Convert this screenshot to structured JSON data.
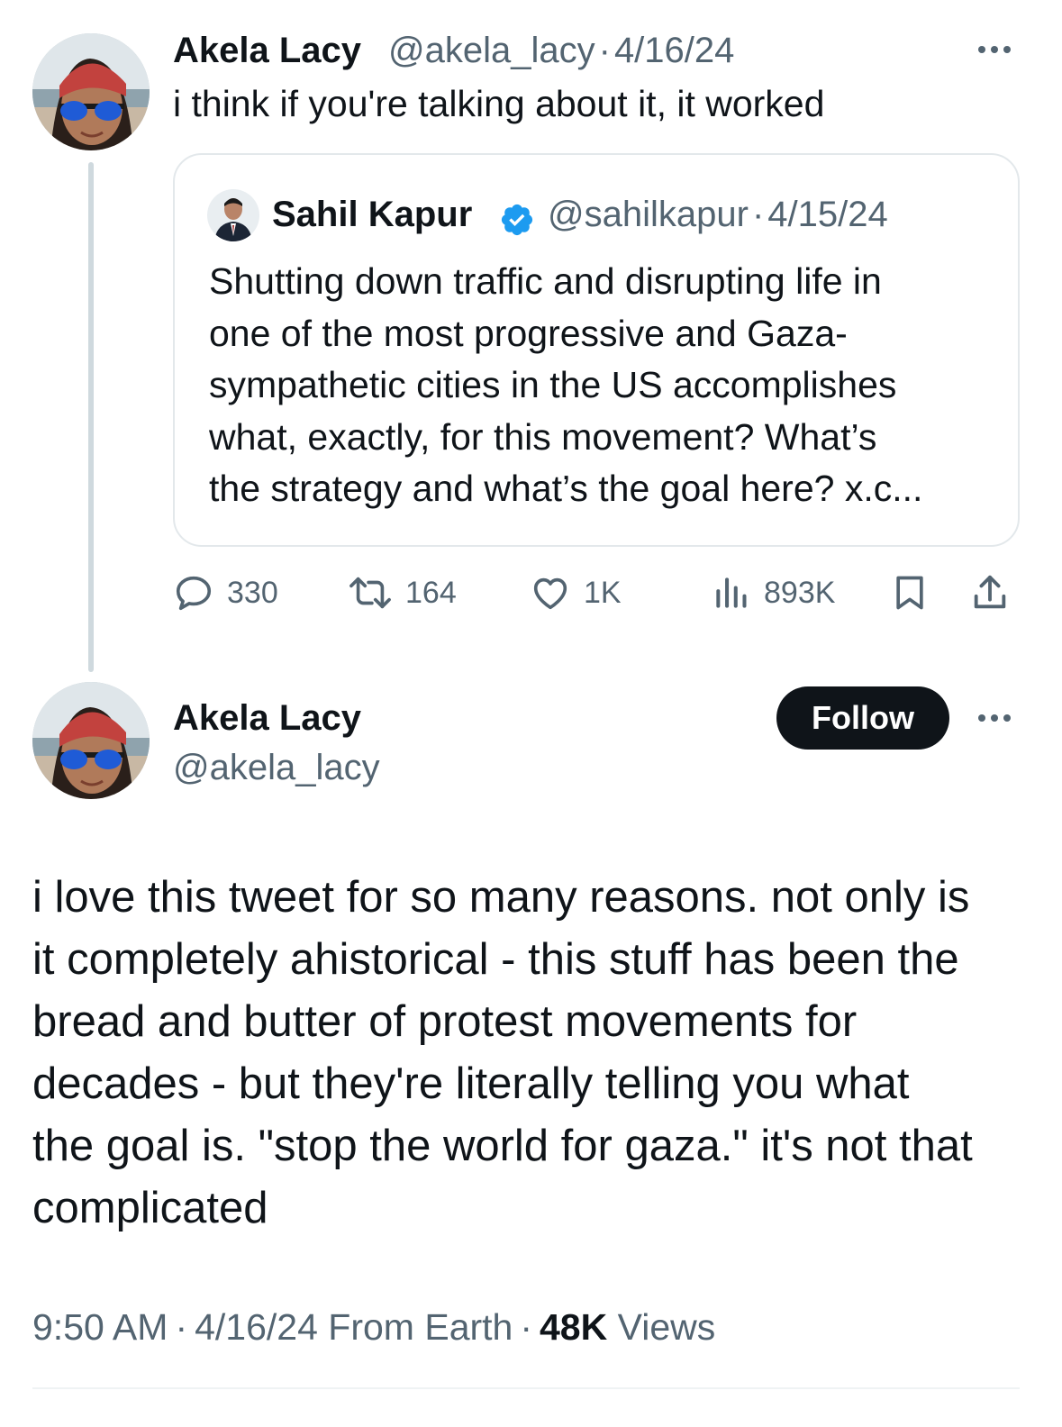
{
  "reply": {
    "author_name": "Akela Lacy",
    "handle": "@akela_lacy",
    "separator": "·",
    "date": "4/16/24",
    "text": "i think if you're talking about it, it worked",
    "more_icon": "more-horizontal-icon"
  },
  "quoted_tweet": {
    "author_name": "Sahil Kapur",
    "verified": true,
    "handle": "@sahilkapur",
    "separator": "·",
    "date": "4/15/24",
    "lines": [
      "Shutting down traffic and disrupting life in",
      "one of the most progressive and Gaza-",
      "sympathetic cities in the US accomplishes",
      "what, exactly, for this movement? What’s",
      "the strategy and what’s the goal here? x.c..."
    ]
  },
  "actions": {
    "replies": "330",
    "reposts": "164",
    "likes": "1K",
    "views": "893K",
    "bookmark_icon": "bookmark-icon",
    "share_icon": "share-icon"
  },
  "main_tweet": {
    "author_name": "Akela Lacy",
    "handle": "@akela_lacy",
    "follow_label": "Follow",
    "lines": [
      "i love this tweet for so many reasons. not only is",
      "it completely ahistorical - this stuff has been the",
      "bread and butter of protest movements for",
      "decades - but they're literally telling you what",
      "the goal is. \"stop the world for gaza.\" it's not that",
      "complicated"
    ],
    "time": "9:50 AM",
    "sep1": "·",
    "date": "4/16/24",
    "source": "From Earth",
    "sep2": "·",
    "views_count": "48K",
    "views_label": "Views"
  },
  "colors": {
    "text": "#0f1419",
    "muted": "#536471",
    "verified_blue": "#1d9bf0",
    "follow_bg": "#0f1419",
    "border": "#e3e8eb"
  }
}
